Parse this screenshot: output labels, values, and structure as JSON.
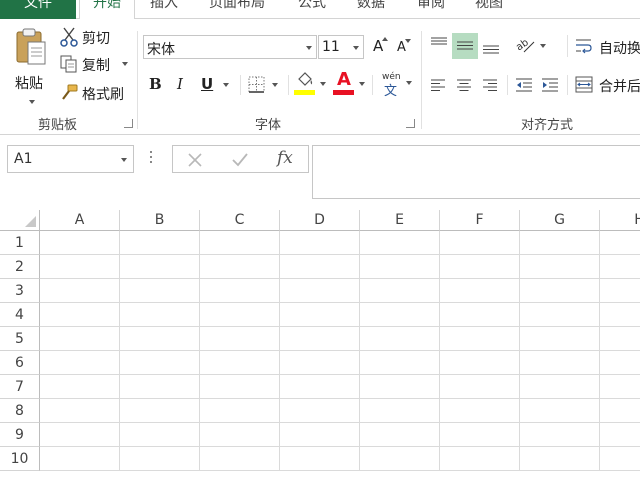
{
  "tabs": [
    {
      "label": "文件"
    },
    {
      "label": "开始"
    },
    {
      "label": "插入"
    },
    {
      "label": "页面布局"
    },
    {
      "label": "公式"
    },
    {
      "label": "数据"
    },
    {
      "label": "审阅"
    },
    {
      "label": "视图"
    }
  ],
  "clipboard": {
    "paste": "粘贴",
    "cut": "剪切",
    "copy": "复制",
    "format_painter": "格式刷",
    "group_label": "剪贴板"
  },
  "font": {
    "name": "宋体",
    "size": "11",
    "bold": "B",
    "italic": "I",
    "underline": "U",
    "grow": "A",
    "shrink": "A",
    "font_color_letter": "A",
    "phonetic_top": "wén",
    "phonetic_bottom": "文",
    "group_label": "字体",
    "highlight_color": "#ffff00",
    "font_color": "#e81123"
  },
  "alignment": {
    "wrap_text": "自动换",
    "merge_center": "合并后",
    "group_label": "对齐方式",
    "active_color": "#b6dcc1"
  },
  "formula_bar": {
    "name_box": "A1",
    "fx": "fx"
  },
  "grid": {
    "columns": [
      "A",
      "B",
      "C",
      "D",
      "E",
      "F",
      "G",
      "H"
    ],
    "rows": [
      "1",
      "2",
      "3",
      "4",
      "5",
      "6",
      "7",
      "8",
      "9",
      "10"
    ]
  },
  "accent": "#217346"
}
